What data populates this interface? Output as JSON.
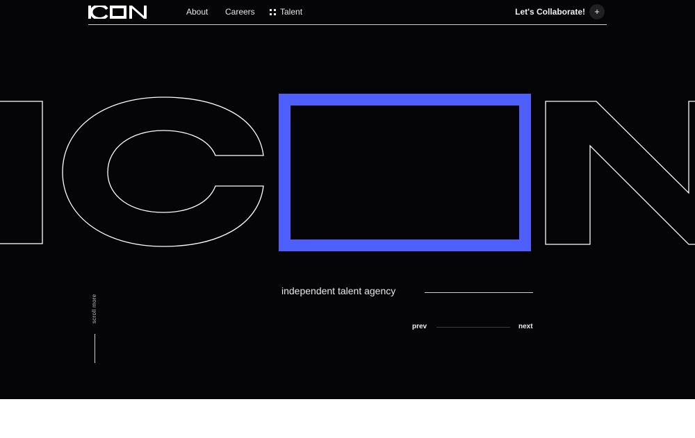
{
  "brand": {
    "logo_text": "ICON"
  },
  "nav": {
    "items": [
      {
        "label": "About"
      },
      {
        "label": "Careers"
      },
      {
        "label": "Talent",
        "icon": "grid-dots-icon"
      }
    ]
  },
  "cta": {
    "label": "Let's Collaborate!",
    "icon": "plus-icon",
    "icon_glyph": "+"
  },
  "hero": {
    "big_letters": [
      "I",
      "C",
      "O",
      "N"
    ],
    "accent_color": "#4f5ffb",
    "background": "#050407",
    "tagline": "independent talent agency",
    "prev_label": "prev",
    "next_label": "next",
    "scroll_label": "scroll more"
  }
}
